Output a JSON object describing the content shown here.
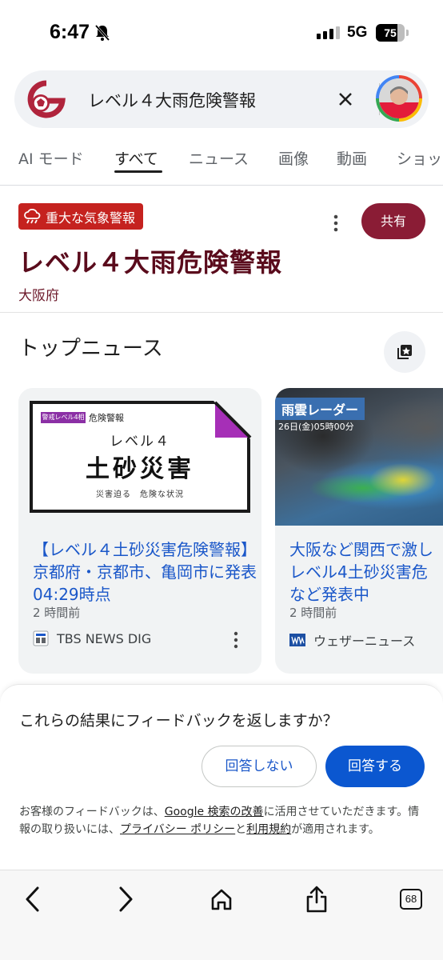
{
  "status_bar": {
    "time": "6:47",
    "network": "5G",
    "battery": "75",
    "battery_level": 0.75
  },
  "search": {
    "query": "レベル４大雨危険警報"
  },
  "tabs": [
    {
      "label": "AI モード"
    },
    {
      "label": "すべて",
      "active": true
    },
    {
      "label": "ニュース"
    },
    {
      "label": "画像"
    },
    {
      "label": "動画"
    },
    {
      "label": "ショッ"
    }
  ],
  "alert": {
    "badge": "重大な気象警報",
    "title": "レベル４大雨危険警報",
    "region": "大阪府",
    "share_label": "共有"
  },
  "top_news": {
    "heading": "トップニュース",
    "cards": [
      {
        "thumb": {
          "tag": "警戒レベル4相当",
          "label": "危険警報",
          "level": "レベル４",
          "headline": "土砂災害",
          "caption": "災害迫る　危険な状況"
        },
        "headline": "【レベル４土砂災害危険警報】京都府・京都市、亀岡市に発表 04:29時点",
        "time": "2 時間前",
        "source": "TBS NEWS DIG"
      },
      {
        "thumb": {
          "title": "雨雲レーダー",
          "date": "26日(金)05時00分"
        },
        "headline_lines": [
          "大阪など関西で激し",
          "レベル4土砂災害危",
          "など発表中"
        ],
        "time": "2 時間前",
        "source": "ウェザーニュース"
      }
    ]
  },
  "feedback": {
    "question": "これらの結果にフィードバックを返しますか？",
    "no_label": "回答しない",
    "yes_label": "回答する",
    "note_prefix": "お客様のフィードバックは、",
    "note_link1": "Google 検索の改善",
    "note_mid": "に活用させていただきます。情報の取り扱いには、",
    "note_link2": "プライバシー ポリシー",
    "note_and": "と",
    "note_link3": "利用規約",
    "note_suffix": "が適用されます。"
  },
  "toolbar": {
    "tabs_count": "68"
  },
  "colors": {
    "alert_red": "#c5221f",
    "title_maroon": "#5a0b1c",
    "share_bg": "#8a1c35",
    "link_blue": "#1a57c9",
    "primary_blue": "#0b57d0"
  }
}
